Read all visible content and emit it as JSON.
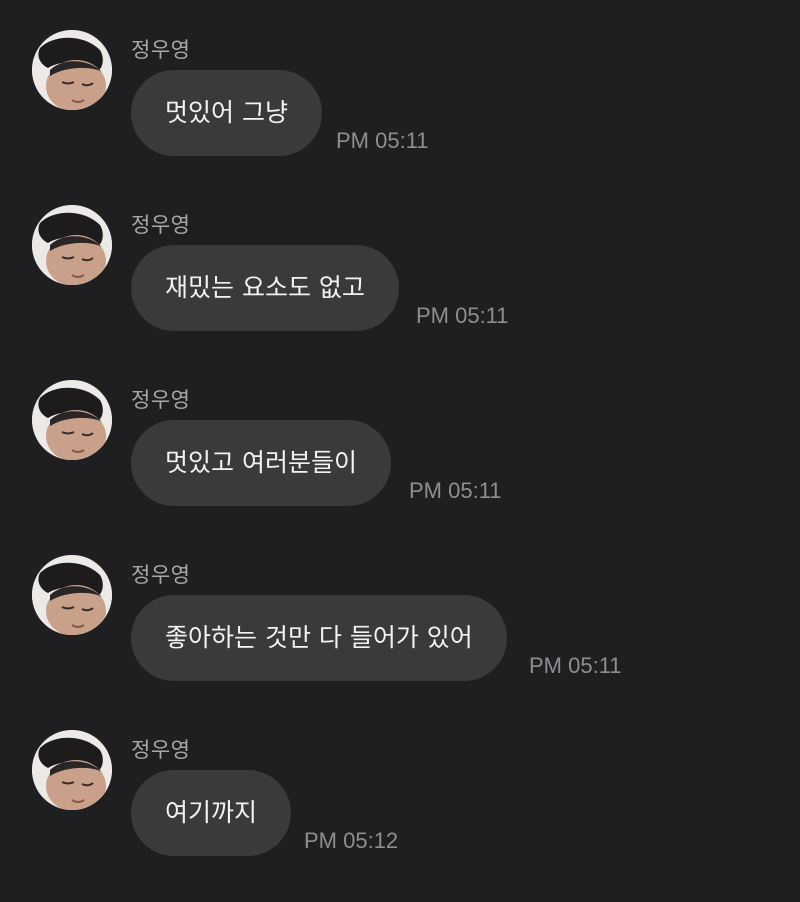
{
  "messages": [
    {
      "sender": "정우영",
      "text": "멋있어 그냥",
      "time": "PM 05:11"
    },
    {
      "sender": "정우영",
      "text": "재밌는 요소도 없고",
      "time": "PM 05:11"
    },
    {
      "sender": "정우영",
      "text": "멋있고 여러분들이",
      "time": "PM 05:11"
    },
    {
      "sender": "정우영",
      "text": "좋아하는 것만 다 들어가 있어",
      "time": "PM 05:11"
    },
    {
      "sender": "정우영",
      "text": "여기까지",
      "time": "PM 05:12"
    }
  ],
  "colors": {
    "background": "#1f1f21",
    "bubble": "#3a3a3c",
    "sender_text": "#a8a8aa",
    "message_text": "#f2f2f4",
    "time_text": "#8e8e92"
  },
  "icons": {
    "avatar": "profile-photo-avatar-icon"
  }
}
